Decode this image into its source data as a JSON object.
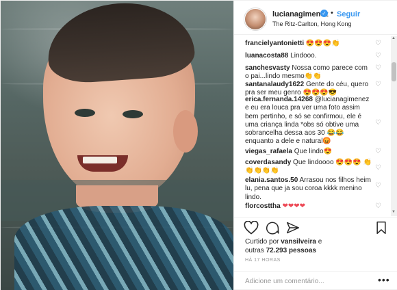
{
  "header": {
    "username": "lucianagimenez",
    "follow_label": "Seguir",
    "separator": "•",
    "location": "The Ritz-Carlton, Hong Kong"
  },
  "comments": [
    {
      "user": "francielyantonietti",
      "text": "😍😍😍👏"
    },
    {
      "user": "luanacosta88",
      "text": "Lindooo."
    },
    {
      "user": "sanchesvasty",
      "text": "Nossa como parece com o pai...lindo mesmo👏👏"
    },
    {
      "user": "santanalaudy1622",
      "text": "Gente do céu, quero pra ser meu genro 😍😍😍😎"
    },
    {
      "user": "erica.fernanda.14268",
      "text": "@lucianagimenez e eu era louca pra ver uma foto assim bem pertinho, e só se confirmou, ele é uma criança linda *obs só obtive uma sobrancelha dessa aos 30 😂😂 enquanto a dele e natural😡"
    },
    {
      "user": "viegas_rafaela",
      "text": "Que lindo😍"
    },
    {
      "user": "coverdasandy",
      "text": "Que lindoooo 😍😍😍 👏👏👏👏👏"
    },
    {
      "user": "elania.santos.50",
      "text": "Arrasou nos filhos heim lu, pena que ja sou coroa kkkk menino lindo."
    },
    {
      "user": "florcosttha",
      "text": "❤❤❤❤"
    }
  ],
  "likes": {
    "prefix": "Curtido por ",
    "user": "vansilveira",
    "middle": " e",
    "line2_prefix": "outras ",
    "count": "72.293 pessoas"
  },
  "time": "HÁ 17 HORAS",
  "add_comment": {
    "placeholder": "Adicione um comentário...",
    "more": "•••"
  },
  "icons": {
    "heart": "heart-icon",
    "comment": "comment-icon",
    "share": "share-icon",
    "save": "bookmark-icon",
    "verified": "verified-badge-icon"
  }
}
